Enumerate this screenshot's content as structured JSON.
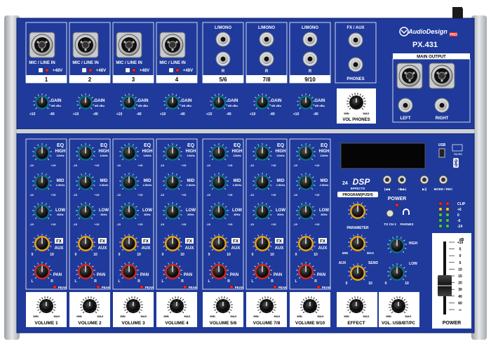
{
  "brand": {
    "name": "AudioDesign",
    "sub": "PRO",
    "model": "PX.431"
  },
  "inputs": [
    {
      "number": "1",
      "jack_label": "MIC / LINE IN",
      "phantom": "+48V"
    },
    {
      "number": "2",
      "jack_label": "MIC / LINE IN",
      "phantom": "+48V"
    },
    {
      "number": "3",
      "jack_label": "MIC / LINE IN",
      "phantom": "+48V"
    },
    {
      "number": "4",
      "jack_label": "MIC / LINE IN",
      "phantom": "+48V"
    }
  ],
  "stereo_inputs": [
    {
      "number": "5/6",
      "top": "L/MONO",
      "bottom": "R"
    },
    {
      "number": "7/8",
      "top": "L/MONO",
      "bottom": "R"
    },
    {
      "number": "9/10",
      "top": "L/MONO",
      "bottom": "R"
    }
  ],
  "fx_aux": {
    "label": "FX / AUX",
    "phones": "PHONES"
  },
  "main_output": {
    "label": "MAIN OUTPUT",
    "left": "LEFT",
    "right": "RIGHT"
  },
  "gain": {
    "label": "GAIN",
    "sub": "dB dBu",
    "min": "+10",
    "max": "-40"
  },
  "vol_phones": {
    "label": "VOL PHONES",
    "min": "MIN",
    "max": "MAX"
  },
  "eq": {
    "title": "EQ",
    "bands": [
      {
        "name": "HIGH",
        "freq": "12kHz"
      },
      {
        "name": "MID",
        "freq": "2.5kHz"
      },
      {
        "name": "LOW",
        "freq": "80Hz"
      }
    ],
    "min": "-15",
    "max": "+15"
  },
  "fx_aux_knob": {
    "top": "FX",
    "bottom": "AUX",
    "min": "0",
    "max": "10"
  },
  "pan": {
    "label": "PAN",
    "left": "L",
    "right": "R",
    "peak": "PEAK"
  },
  "channel_volumes": [
    "VOLUME 1",
    "VOLUME 2",
    "VOLUME 3",
    "VOLUME 4",
    "VOLUME 5/6",
    "VOLUME 7/8",
    "VOLUME 9/10"
  ],
  "knob_range": {
    "min": "MIN",
    "max": "MAX"
  },
  "usb": {
    "label": "USB",
    "to_pc": "TO PC"
  },
  "player_buttons": [
    "|◀◀",
    "+/▶▶|",
    "▶||",
    "MODE / REC"
  ],
  "dsp": {
    "digits": "24",
    "label": "DSP",
    "sub": "EFFECTS",
    "program": "PROGRAM(PUSH)",
    "parameter": "PARAMETER",
    "aux": "AUX",
    "send": "SEND",
    "min": "MIN",
    "max": "MAX",
    "effect": "EFFECT"
  },
  "power": {
    "label": "POWER",
    "bottom": "POWER"
  },
  "to_ch": {
    "to_ch": "TO CH 2",
    "phones": "PHONES"
  },
  "usb_eq": {
    "high": "HIGH",
    "low": "LOW",
    "min": "MIN",
    "max": "MAX",
    "volume": "VOL. USB/BT/PC"
  },
  "meter": {
    "labels": [
      "CLIP",
      "+6",
      "0",
      "-6",
      "-24"
    ]
  },
  "fader": {
    "db": "dB",
    "scale": [
      "+10",
      "5",
      "0",
      "5",
      "10",
      "15",
      "20",
      "30",
      "40",
      "60",
      "∞"
    ]
  }
}
